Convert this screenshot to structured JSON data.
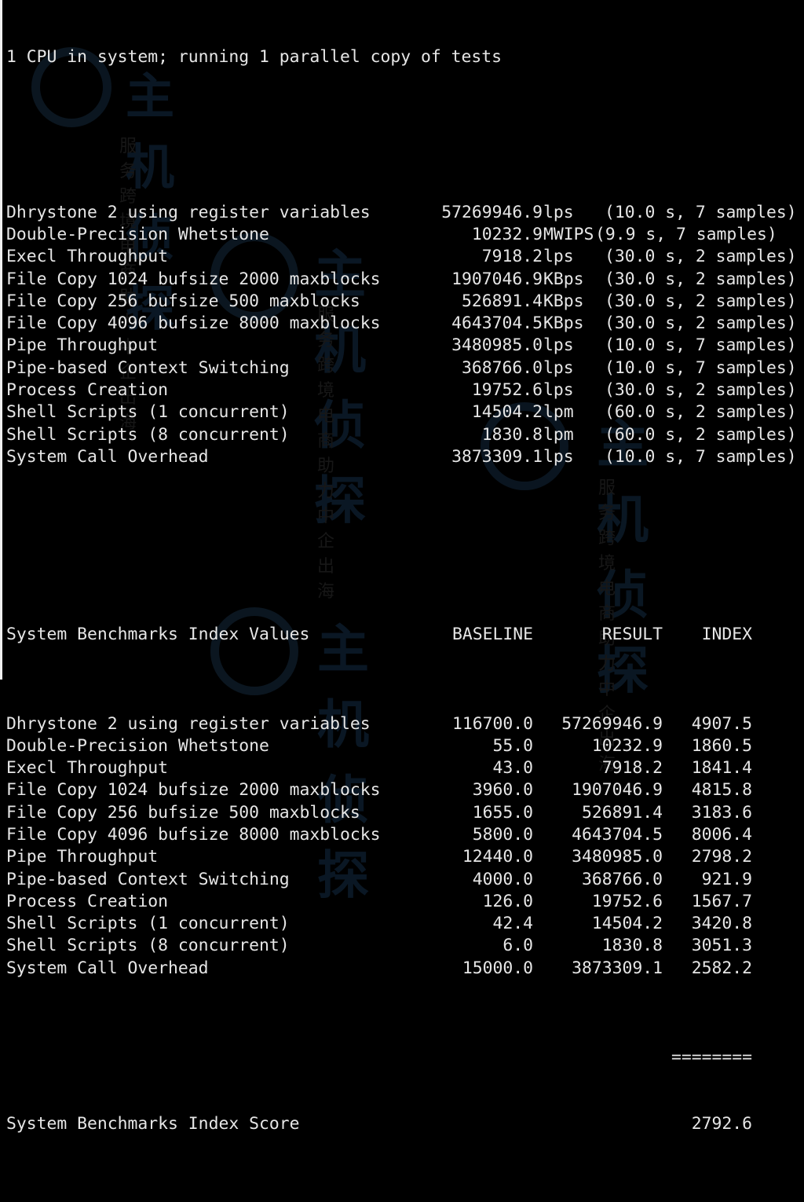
{
  "terminal": {
    "header_line": "1 CPU in system; running 1 parallel copy of tests",
    "raw_results": [
      {
        "name": "Dhrystone 2 using register variables",
        "value": "57269946.9",
        "unit": "lps",
        "details": "(10.0 s, 7 samples)"
      },
      {
        "name": "Double-Precision Whetstone",
        "value": "10232.9",
        "unit": "MWIPS",
        "details": "(9.9 s, 7 samples)"
      },
      {
        "name": "Execl Throughput",
        "value": "7918.2",
        "unit": "lps",
        "details": "(30.0 s, 2 samples)"
      },
      {
        "name": "File Copy 1024 bufsize 2000 maxblocks",
        "value": "1907046.9",
        "unit": "KBps",
        "details": "(30.0 s, 2 samples)"
      },
      {
        "name": "File Copy 256 bufsize 500 maxblocks",
        "value": "526891.4",
        "unit": "KBps",
        "details": "(30.0 s, 2 samples)"
      },
      {
        "name": "File Copy 4096 bufsize 8000 maxblocks",
        "value": "4643704.5",
        "unit": "KBps",
        "details": "(30.0 s, 2 samples)"
      },
      {
        "name": "Pipe Throughput",
        "value": "3480985.0",
        "unit": "lps",
        "details": "(10.0 s, 7 samples)"
      },
      {
        "name": "Pipe-based Context Switching",
        "value": "368766.0",
        "unit": "lps",
        "details": "(10.0 s, 7 samples)"
      },
      {
        "name": "Process Creation",
        "value": "19752.6",
        "unit": "lps",
        "details": "(30.0 s, 2 samples)"
      },
      {
        "name": "Shell Scripts (1 concurrent)",
        "value": "14504.2",
        "unit": "lpm",
        "details": "(60.0 s, 2 samples)"
      },
      {
        "name": "Shell Scripts (8 concurrent)",
        "value": "1830.8",
        "unit": "lpm",
        "details": "(60.0 s, 2 samples)"
      },
      {
        "name": "System Call Overhead",
        "value": "3873309.1",
        "unit": "lps",
        "details": "(10.0 s, 7 samples)"
      }
    ],
    "index_table": {
      "title": "System Benchmarks Index Values",
      "headers": {
        "baseline": "BASELINE",
        "result": "RESULT",
        "index": "INDEX"
      },
      "rows": [
        {
          "name": "Dhrystone 2 using register variables",
          "baseline": "116700.0",
          "result": "57269946.9",
          "index": "4907.5"
        },
        {
          "name": "Double-Precision Whetstone",
          "baseline": "55.0",
          "result": "10232.9",
          "index": "1860.5"
        },
        {
          "name": "Execl Throughput",
          "baseline": "43.0",
          "result": "7918.2",
          "index": "1841.4"
        },
        {
          "name": "File Copy 1024 bufsize 2000 maxblocks",
          "baseline": "3960.0",
          "result": "1907046.9",
          "index": "4815.8"
        },
        {
          "name": "File Copy 256 bufsize 500 maxblocks",
          "baseline": "1655.0",
          "result": "526891.4",
          "index": "3183.6"
        },
        {
          "name": "File Copy 4096 bufsize 8000 maxblocks",
          "baseline": "5800.0",
          "result": "4643704.5",
          "index": "8006.4"
        },
        {
          "name": "Pipe Throughput",
          "baseline": "12440.0",
          "result": "3480985.0",
          "index": "2798.2"
        },
        {
          "name": "Pipe-based Context Switching",
          "baseline": "4000.0",
          "result": "368766.0",
          "index": "921.9"
        },
        {
          "name": "Process Creation",
          "baseline": "126.0",
          "result": "19752.6",
          "index": "1567.7"
        },
        {
          "name": "Shell Scripts (1 concurrent)",
          "baseline": "42.4",
          "result": "14504.2",
          "index": "3420.8"
        },
        {
          "name": "Shell Scripts (8 concurrent)",
          "baseline": "6.0",
          "result": "1830.8",
          "index": "3051.3"
        },
        {
          "name": "System Call Overhead",
          "baseline": "15000.0",
          "result": "3873309.1",
          "index": "2582.2"
        }
      ],
      "separator": "========",
      "score_label": "System Benchmarks Index Score",
      "score_value": "2792.6"
    }
  },
  "watermark": {
    "brand_text": "主机侦探",
    "slogan": "服务跨境电商 助力中企出海",
    "icon": "globe-logo-icon"
  }
}
